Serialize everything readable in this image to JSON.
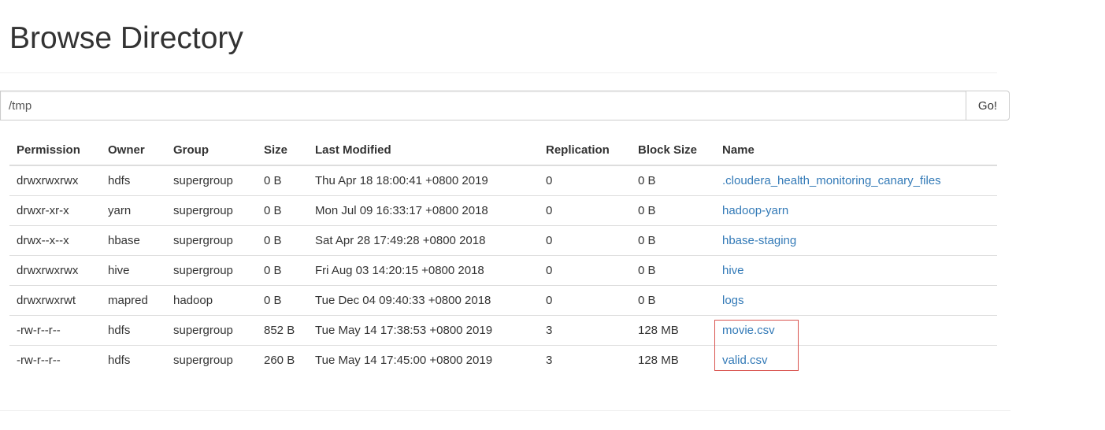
{
  "page": {
    "title": "Browse Directory"
  },
  "path_form": {
    "value": "/tmp",
    "go_label": "Go!"
  },
  "table": {
    "headers": {
      "permission": "Permission",
      "owner": "Owner",
      "group": "Group",
      "size": "Size",
      "last_modified": "Last Modified",
      "replication": "Replication",
      "block_size": "Block Size",
      "name": "Name"
    },
    "rows": [
      {
        "permission": "drwxrwxrwx",
        "owner": "hdfs",
        "group": "supergroup",
        "size": "0 B",
        "last_modified": "Thu Apr 18 18:00:41 +0800 2019",
        "replication": "0",
        "block_size": "0 B",
        "name": ".cloudera_health_monitoring_canary_files"
      },
      {
        "permission": "drwxr-xr-x",
        "owner": "yarn",
        "group": "supergroup",
        "size": "0 B",
        "last_modified": "Mon Jul 09 16:33:17 +0800 2018",
        "replication": "0",
        "block_size": "0 B",
        "name": "hadoop-yarn"
      },
      {
        "permission": "drwx--x--x",
        "owner": "hbase",
        "group": "supergroup",
        "size": "0 B",
        "last_modified": "Sat Apr 28 17:49:28 +0800 2018",
        "replication": "0",
        "block_size": "0 B",
        "name": "hbase-staging"
      },
      {
        "permission": "drwxrwxrwx",
        "owner": "hive",
        "group": "supergroup",
        "size": "0 B",
        "last_modified": "Fri Aug 03 14:20:15 +0800 2018",
        "replication": "0",
        "block_size": "0 B",
        "name": "hive"
      },
      {
        "permission": "drwxrwxrwt",
        "owner": "mapred",
        "group": "hadoop",
        "size": "0 B",
        "last_modified": "Tue Dec 04 09:40:33 +0800 2018",
        "replication": "0",
        "block_size": "0 B",
        "name": "logs"
      },
      {
        "permission": "-rw-r--r--",
        "owner": "hdfs",
        "group": "supergroup",
        "size": "852 B",
        "last_modified": "Tue May 14 17:38:53 +0800 2019",
        "replication": "3",
        "block_size": "128 MB",
        "name": "movie.csv"
      },
      {
        "permission": "-rw-r--r--",
        "owner": "hdfs",
        "group": "supergroup",
        "size": "260 B",
        "last_modified": "Tue May 14 17:45:00 +0800 2019",
        "replication": "3",
        "block_size": "128 MB",
        "name": "valid.csv"
      }
    ]
  },
  "colors": {
    "link": "#337ab7",
    "highlight_border": "#d9534f"
  }
}
